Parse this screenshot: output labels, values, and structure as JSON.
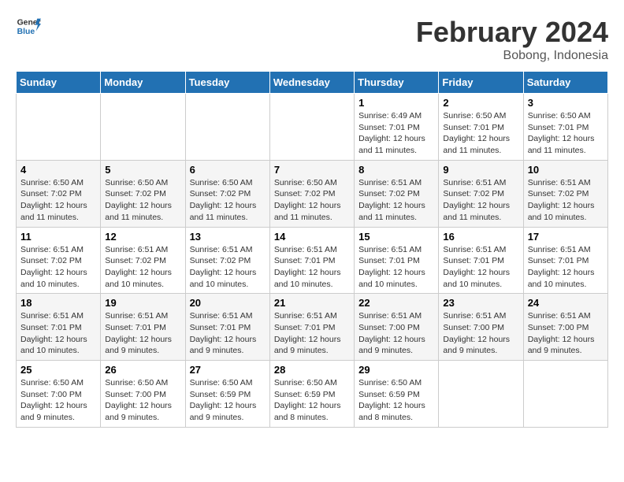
{
  "header": {
    "logo_line1": "General",
    "logo_line2": "Blue",
    "month_title": "February 2024",
    "subtitle": "Bobong, Indonesia"
  },
  "days_of_week": [
    "Sunday",
    "Monday",
    "Tuesday",
    "Wednesday",
    "Thursday",
    "Friday",
    "Saturday"
  ],
  "weeks": [
    {
      "days": [
        {
          "num": "",
          "info": ""
        },
        {
          "num": "",
          "info": ""
        },
        {
          "num": "",
          "info": ""
        },
        {
          "num": "",
          "info": ""
        },
        {
          "num": "1",
          "info": "Sunrise: 6:49 AM\nSunset: 7:01 PM\nDaylight: 12 hours\nand 11 minutes."
        },
        {
          "num": "2",
          "info": "Sunrise: 6:50 AM\nSunset: 7:01 PM\nDaylight: 12 hours\nand 11 minutes."
        },
        {
          "num": "3",
          "info": "Sunrise: 6:50 AM\nSunset: 7:01 PM\nDaylight: 12 hours\nand 11 minutes."
        }
      ]
    },
    {
      "days": [
        {
          "num": "4",
          "info": "Sunrise: 6:50 AM\nSunset: 7:02 PM\nDaylight: 12 hours\nand 11 minutes."
        },
        {
          "num": "5",
          "info": "Sunrise: 6:50 AM\nSunset: 7:02 PM\nDaylight: 12 hours\nand 11 minutes."
        },
        {
          "num": "6",
          "info": "Sunrise: 6:50 AM\nSunset: 7:02 PM\nDaylight: 12 hours\nand 11 minutes."
        },
        {
          "num": "7",
          "info": "Sunrise: 6:50 AM\nSunset: 7:02 PM\nDaylight: 12 hours\nand 11 minutes."
        },
        {
          "num": "8",
          "info": "Sunrise: 6:51 AM\nSunset: 7:02 PM\nDaylight: 12 hours\nand 11 minutes."
        },
        {
          "num": "9",
          "info": "Sunrise: 6:51 AM\nSunset: 7:02 PM\nDaylight: 12 hours\nand 11 minutes."
        },
        {
          "num": "10",
          "info": "Sunrise: 6:51 AM\nSunset: 7:02 PM\nDaylight: 12 hours\nand 10 minutes."
        }
      ]
    },
    {
      "days": [
        {
          "num": "11",
          "info": "Sunrise: 6:51 AM\nSunset: 7:02 PM\nDaylight: 12 hours\nand 10 minutes."
        },
        {
          "num": "12",
          "info": "Sunrise: 6:51 AM\nSunset: 7:02 PM\nDaylight: 12 hours\nand 10 minutes."
        },
        {
          "num": "13",
          "info": "Sunrise: 6:51 AM\nSunset: 7:02 PM\nDaylight: 12 hours\nand 10 minutes."
        },
        {
          "num": "14",
          "info": "Sunrise: 6:51 AM\nSunset: 7:01 PM\nDaylight: 12 hours\nand 10 minutes."
        },
        {
          "num": "15",
          "info": "Sunrise: 6:51 AM\nSunset: 7:01 PM\nDaylight: 12 hours\nand 10 minutes."
        },
        {
          "num": "16",
          "info": "Sunrise: 6:51 AM\nSunset: 7:01 PM\nDaylight: 12 hours\nand 10 minutes."
        },
        {
          "num": "17",
          "info": "Sunrise: 6:51 AM\nSunset: 7:01 PM\nDaylight: 12 hours\nand 10 minutes."
        }
      ]
    },
    {
      "days": [
        {
          "num": "18",
          "info": "Sunrise: 6:51 AM\nSunset: 7:01 PM\nDaylight: 12 hours\nand 10 minutes."
        },
        {
          "num": "19",
          "info": "Sunrise: 6:51 AM\nSunset: 7:01 PM\nDaylight: 12 hours\nand 9 minutes."
        },
        {
          "num": "20",
          "info": "Sunrise: 6:51 AM\nSunset: 7:01 PM\nDaylight: 12 hours\nand 9 minutes."
        },
        {
          "num": "21",
          "info": "Sunrise: 6:51 AM\nSunset: 7:01 PM\nDaylight: 12 hours\nand 9 minutes."
        },
        {
          "num": "22",
          "info": "Sunrise: 6:51 AM\nSunset: 7:00 PM\nDaylight: 12 hours\nand 9 minutes."
        },
        {
          "num": "23",
          "info": "Sunrise: 6:51 AM\nSunset: 7:00 PM\nDaylight: 12 hours\nand 9 minutes."
        },
        {
          "num": "24",
          "info": "Sunrise: 6:51 AM\nSunset: 7:00 PM\nDaylight: 12 hours\nand 9 minutes."
        }
      ]
    },
    {
      "days": [
        {
          "num": "25",
          "info": "Sunrise: 6:50 AM\nSunset: 7:00 PM\nDaylight: 12 hours\nand 9 minutes."
        },
        {
          "num": "26",
          "info": "Sunrise: 6:50 AM\nSunset: 7:00 PM\nDaylight: 12 hours\nand 9 minutes."
        },
        {
          "num": "27",
          "info": "Sunrise: 6:50 AM\nSunset: 6:59 PM\nDaylight: 12 hours\nand 9 minutes."
        },
        {
          "num": "28",
          "info": "Sunrise: 6:50 AM\nSunset: 6:59 PM\nDaylight: 12 hours\nand 8 minutes."
        },
        {
          "num": "29",
          "info": "Sunrise: 6:50 AM\nSunset: 6:59 PM\nDaylight: 12 hours\nand 8 minutes."
        },
        {
          "num": "",
          "info": ""
        },
        {
          "num": "",
          "info": ""
        }
      ]
    }
  ]
}
